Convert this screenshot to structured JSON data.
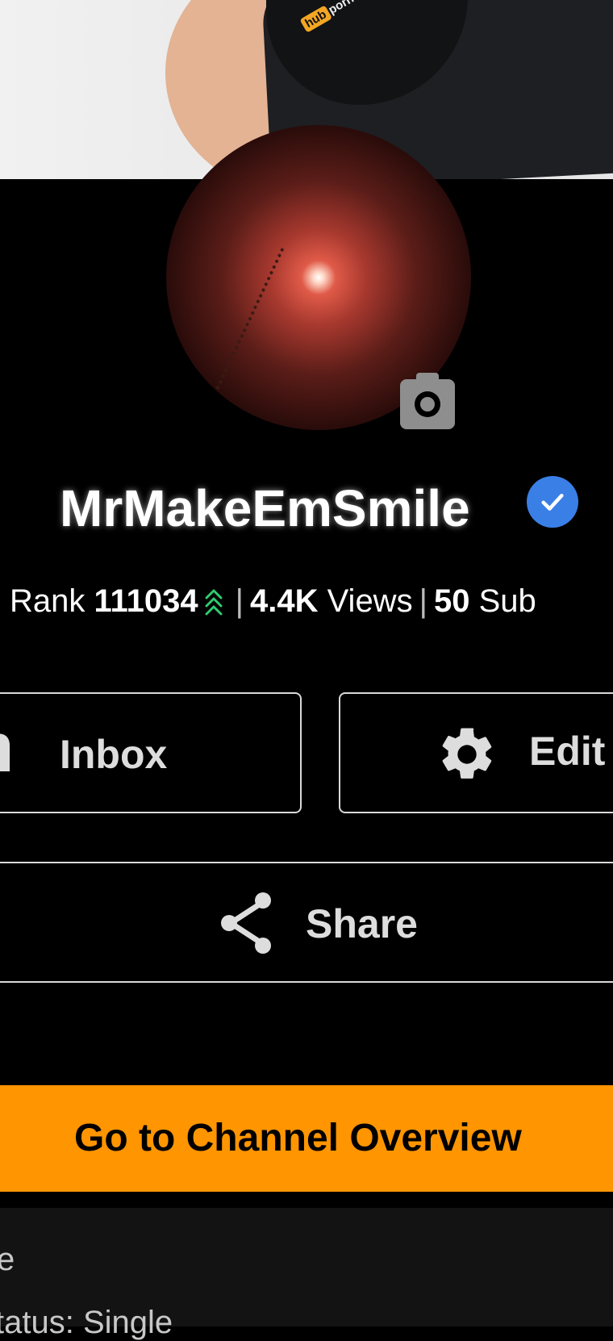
{
  "profile": {
    "username": "MrMakeEmSmile",
    "stats": {
      "rank_label": "Rank",
      "rank_value": "111034",
      "views_value": "4.4K",
      "views_label": "Views",
      "subs_value": "50",
      "subs_label": "Sub"
    }
  },
  "actions": {
    "inbox_label": "Inbox",
    "edit_label": "Edit",
    "share_label": "Share",
    "overview_label": "Go to Channel Overview"
  },
  "about": {
    "line1": "e",
    "line2": "status: Single"
  },
  "cover": {
    "shirt_logo_text": "porn",
    "shirt_logo_badge": "hub"
  },
  "colors": {
    "accent": "#ff9500",
    "verified": "#3a7fe6",
    "rank_up": "#2ecc71"
  },
  "icons": {
    "camera": "camera-icon",
    "verified": "verified-check-icon",
    "rank_up": "rank-up-chevrons-icon",
    "inbox": "inbox-icon",
    "edit": "gear-icon",
    "share": "share-icon"
  }
}
